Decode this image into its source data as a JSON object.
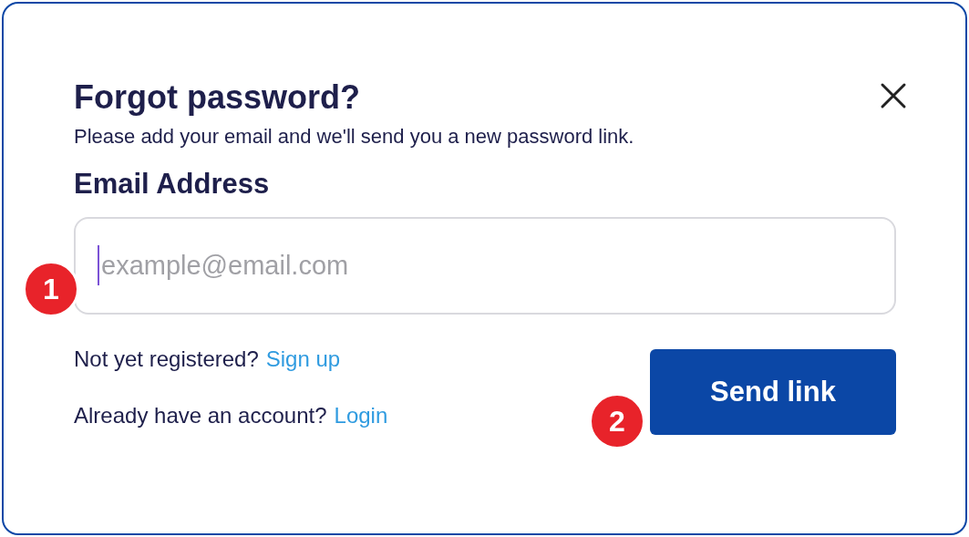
{
  "dialog": {
    "title": "Forgot password?",
    "subtitle": "Please add your email and we'll send you a new password link.",
    "email_label": "Email Address",
    "email_field": {
      "placeholder": "example@email.com"
    },
    "prompts": [
      {
        "text": "Not yet registered?",
        "link": "Sign up"
      },
      {
        "text": "Already have an account?",
        "link": "Login"
      }
    ],
    "button": "Send link"
  },
  "markers": [
    "1",
    "2"
  ]
}
